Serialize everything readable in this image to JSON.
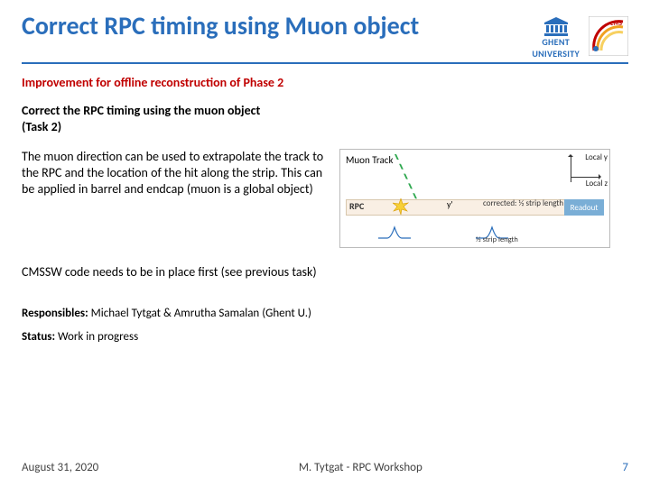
{
  "header": {
    "title": "Correct RPC timing using Muon object",
    "ghent_line1": "GHENT",
    "ghent_line2": "UNIVERSITY",
    "cms_label": "CMS"
  },
  "subhead": "Improvement for offline reconstruction of Phase 2",
  "task_heading_l1": "Correct the RPC timing using the muon object",
  "task_heading_l2": "(Task 2)",
  "body_para": "The muon direction can be used to extrapolate the track to the RPC and the location of the hit along the strip. This can be applied in barrel and endcap (muon is a global object)",
  "diagram": {
    "muon_track": "Muon Track",
    "local_y": "Local y",
    "local_z": "Local z",
    "rpc": "RPC",
    "yprime": "y'",
    "corrected": "corrected: ½ strip length + y'",
    "readout": "Readout",
    "half_strip": "½ strip length"
  },
  "followup": "CMSSW code needs to be in place first (see previous task)",
  "meta": {
    "responsibles_label": "Responsibles:",
    "responsibles_value": " Michael Tytgat & Amrutha Samalan (Ghent U.)",
    "status_label": "Status:",
    "status_value": "  Work in progress"
  },
  "footer": {
    "date": "August 31, 2020",
    "center": "M. Tytgat - RPC Workshop",
    "page": "7"
  }
}
